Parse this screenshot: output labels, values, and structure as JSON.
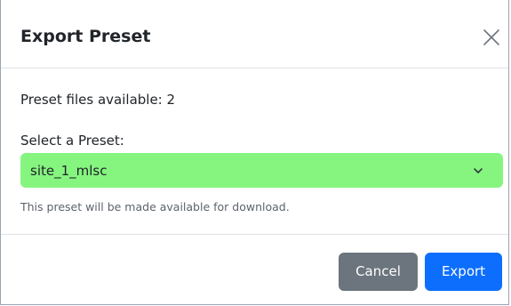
{
  "dialog": {
    "title": "Export Preset",
    "close_icon": "close-icon"
  },
  "body": {
    "count_text": "Preset files available: 2",
    "select_label": "Select a Preset:",
    "select_value": "site_1_mlsc",
    "select_icon": "chevron-down-icon",
    "help_text": "This preset will be made available for download."
  },
  "footer": {
    "cancel_label": "Cancel",
    "export_label": "Export"
  },
  "colors": {
    "select_background": "#85f57f",
    "cancel_button": "#6c757d",
    "export_button": "#0d6efd"
  }
}
